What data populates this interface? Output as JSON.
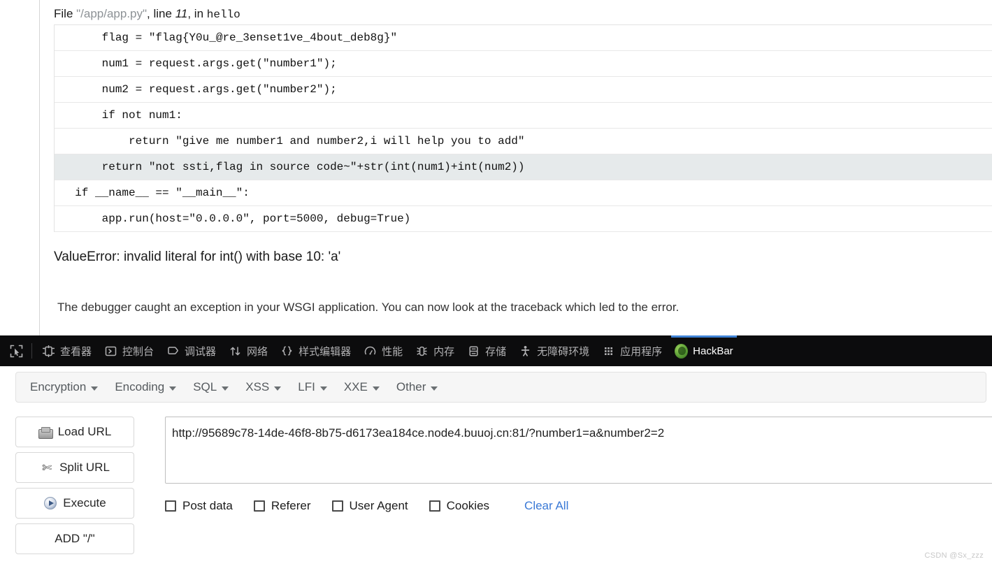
{
  "traceback": {
    "file_prefix": "File ",
    "file_name": "\"/app/app.py\"",
    "line_label": ", line ",
    "line_number": "11",
    "in_label": ", in ",
    "function_name": "hello",
    "code_lines": [
      {
        "text": "      flag = \"flag{Y0u_@re_3enset1ve_4bout_deb8g}\"",
        "highlighted": false
      },
      {
        "text": "      num1 = request.args.get(\"number1\");",
        "highlighted": false
      },
      {
        "text": "      num2 = request.args.get(\"number2\");",
        "highlighted": false
      },
      {
        "text": "      if not num1:",
        "highlighted": false
      },
      {
        "text": "          return \"give me number1 and number2,i will help you to add\"",
        "highlighted": false
      },
      {
        "text": "      return \"not ssti,flag in source code~\"+str(int(num1)+int(num2))",
        "highlighted": true
      },
      {
        "text": "  if __name__ == \"__main__\":",
        "highlighted": false
      },
      {
        "text": "      app.run(host=\"0.0.0.0\", port=5000, debug=True)",
        "highlighted": false
      }
    ],
    "exception": "ValueError: invalid literal for int() with base 10: 'a'",
    "note": "The debugger caught an exception in your WSGI application. You can now look at the traceback which led to the error."
  },
  "devtools": {
    "picker_icon": "element-picker-icon",
    "tabs": [
      {
        "label": "查看器",
        "icon": "inspector-icon",
        "active": false
      },
      {
        "label": "控制台",
        "icon": "console-icon",
        "active": false
      },
      {
        "label": "调试器",
        "icon": "debugger-icon",
        "active": false
      },
      {
        "label": "网络",
        "icon": "network-icon",
        "active": false
      },
      {
        "label": "样式编辑器",
        "icon": "style-editor-icon",
        "active": false
      },
      {
        "label": "性能",
        "icon": "performance-icon",
        "active": false
      },
      {
        "label": "内存",
        "icon": "memory-icon",
        "active": false
      },
      {
        "label": "存储",
        "icon": "storage-icon",
        "active": false
      },
      {
        "label": "无障碍环境",
        "icon": "accessibility-icon",
        "active": false
      },
      {
        "label": "应用程序",
        "icon": "application-icon",
        "active": false
      },
      {
        "label": "HackBar",
        "icon": "hackbar-logo-icon",
        "active": true
      }
    ],
    "active_accent_color": "#4083d6",
    "background_color": "#0c0c0d"
  },
  "hackbar": {
    "menu": [
      {
        "label": "Encryption"
      },
      {
        "label": "Encoding"
      },
      {
        "label": "SQL"
      },
      {
        "label": "XSS"
      },
      {
        "label": "LFI"
      },
      {
        "label": "XXE"
      },
      {
        "label": "Other"
      }
    ],
    "buttons": [
      {
        "label": "Load URL",
        "icon": "disk-icon"
      },
      {
        "label": "Split URL",
        "icon": "scissors-icon"
      },
      {
        "label": "Execute",
        "icon": "play-icon"
      },
      {
        "label": "ADD \"/\"",
        "icon": ""
      }
    ],
    "url_value": "http://95689c78-14de-46f8-8b75-d6173ea184ce.node4.buuoj.cn:81/?number1=a&number2=2",
    "url_placeholder": "",
    "options": [
      {
        "label": "Post data",
        "checked": false
      },
      {
        "label": "Referer",
        "checked": false
      },
      {
        "label": "User Agent",
        "checked": false
      },
      {
        "label": "Cookies",
        "checked": false
      }
    ],
    "clear_all_label": "Clear All",
    "clear_all_color": "#3a79d6"
  },
  "watermark": "CSDN @Sx_zzz"
}
